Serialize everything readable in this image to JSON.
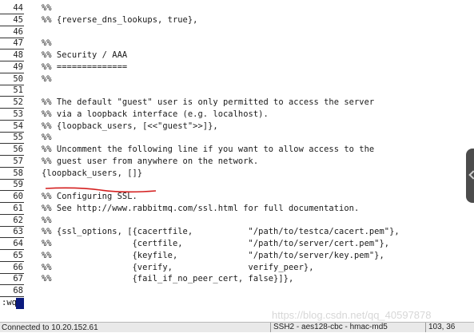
{
  "editor": {
    "lines": [
      {
        "num": "44",
        "text": "%%"
      },
      {
        "num": "45",
        "text": "%% {reverse_dns_lookups, true},"
      },
      {
        "num": "46",
        "text": ""
      },
      {
        "num": "47",
        "text": "%%"
      },
      {
        "num": "48",
        "text": "%% Security / AAA"
      },
      {
        "num": "49",
        "text": "%% =============="
      },
      {
        "num": "50",
        "text": "%%"
      },
      {
        "num": "51",
        "text": ""
      },
      {
        "num": "52",
        "text": "%% The default \"guest\" user is only permitted to access the server"
      },
      {
        "num": "53",
        "text": "%% via a loopback interface (e.g. localhost)."
      },
      {
        "num": "54",
        "text": "%% {loopback_users, [<<\"guest\">>]},"
      },
      {
        "num": "55",
        "text": "%%"
      },
      {
        "num": "56",
        "text": "%% Uncomment the following line if you want to allow access to the"
      },
      {
        "num": "57",
        "text": "%% guest user from anywhere on the network."
      },
      {
        "num": "58",
        "text": "{loopback_users, []}"
      },
      {
        "num": "59",
        "text": ""
      },
      {
        "num": "60",
        "text": "%% Configuring SSL."
      },
      {
        "num": "61",
        "text": "%% See http://www.rabbitmq.com/ssl.html for full documentation."
      },
      {
        "num": "62",
        "text": "%%"
      },
      {
        "num": "63",
        "text": "%% {ssl_options, [{cacertfile,           \"/path/to/testca/cacert.pem\"},"
      },
      {
        "num": "64",
        "text": "%%                {certfile,             \"/path/to/server/cert.pem\"},"
      },
      {
        "num": "65",
        "text": "%%                {keyfile,              \"/path/to/server/key.pem\"},"
      },
      {
        "num": "66",
        "text": "%%                {verify,               verify_peer},"
      },
      {
        "num": "67",
        "text": "%%                {fail_if_no_peer_cert, false}]},"
      },
      {
        "num": "68",
        "text": ""
      }
    ]
  },
  "command": {
    "text": ":wq"
  },
  "watermark": "https://blog.csdn.net/qq_40597878",
  "statusbar": {
    "left": "Connected to 10.20.152.61",
    "protocol": "SSH2 - aes128-cbc - hmac-md5",
    "position": "103, 36"
  },
  "colors": {
    "annotation": "#d42020",
    "cursor": "#0b1a7e"
  }
}
